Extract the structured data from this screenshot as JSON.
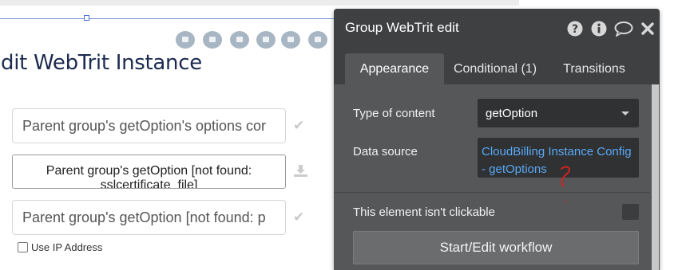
{
  "canvas": {
    "page_title": "dit WebTrit Instance",
    "fields": [
      "Parent group's getOption's options cor",
      "Parent group's getOption [not found: p"
    ],
    "upload": {
      "line1": "Parent group's getOption [not found:",
      "line2": "sslcertificate_file]"
    },
    "checkbox_label": "Use IP Address",
    "check_glyph": "✔"
  },
  "panel": {
    "title": "Group WebTrit edit",
    "header_icons": [
      "help-icon",
      "info-icon",
      "comment-icon",
      "close-icon"
    ],
    "tabs": [
      {
        "label": "Appearance",
        "active": true
      },
      {
        "label": "Conditional (1)",
        "active": false
      },
      {
        "label": "Transitions",
        "active": false
      }
    ],
    "type_of_content": {
      "label": "Type of content",
      "value": "getOption"
    },
    "data_source": {
      "label": "Data source",
      "value": "CloudBilling Instance Config - getOptions"
    },
    "not_clickable": {
      "label": "This element isn't clickable",
      "checked": false
    },
    "workflow_button": "Start/Edit workflow"
  },
  "colors": {
    "panel_bg": "#555759",
    "header_bg": "#3e4042",
    "expression_blue": "#5aa9f5",
    "annotation_red": "#d42020",
    "title_navy": "#1c2a4f"
  }
}
